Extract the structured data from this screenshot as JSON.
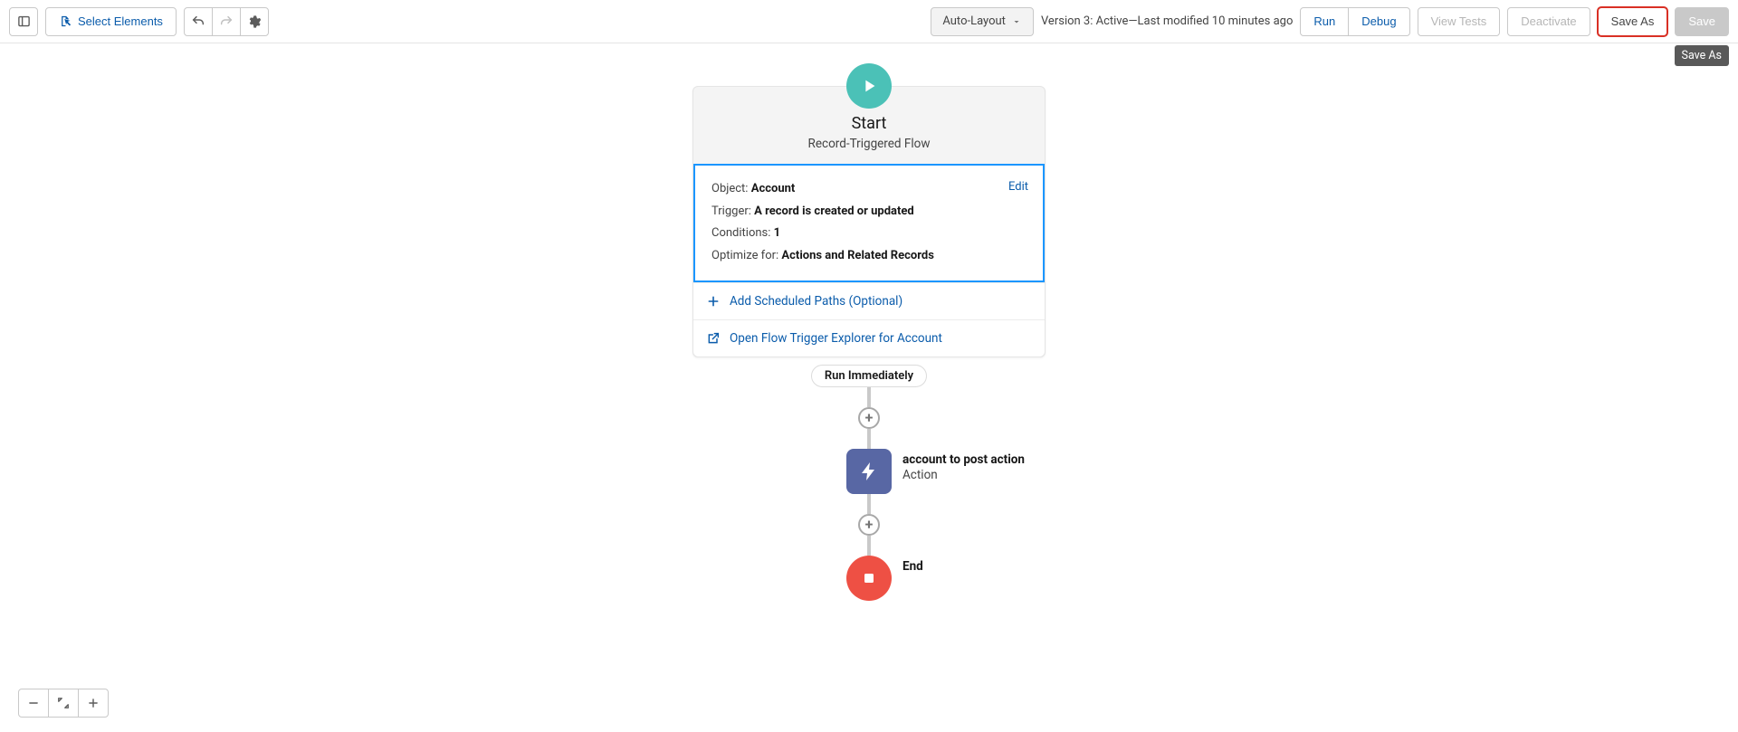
{
  "toolbar": {
    "select_elements": "Select Elements",
    "layout_mode": "Auto-Layout",
    "version_text": "Version 3: Active—Last modified 10 minutes ago",
    "run": "Run",
    "debug": "Debug",
    "view_tests": "View Tests",
    "deactivate": "Deactivate",
    "save_as": "Save As",
    "save": "Save",
    "save_as_tooltip": "Save As"
  },
  "start": {
    "title": "Start",
    "subtitle": "Record-Triggered Flow",
    "edit": "Edit",
    "object_label": "Object:",
    "object_value": "Account",
    "trigger_label": "Trigger:",
    "trigger_value": "A record is created or updated",
    "conditions_label": "Conditions:",
    "conditions_value": "1",
    "optimize_label": "Optimize for:",
    "optimize_value": "Actions and Related Records",
    "add_paths": "Add Scheduled Paths (Optional)",
    "open_explorer": "Open Flow Trigger Explorer for Account"
  },
  "flow": {
    "run_label": "Run Immediately",
    "action_name": "account to post action",
    "action_type": "Action",
    "end_label": "End"
  }
}
